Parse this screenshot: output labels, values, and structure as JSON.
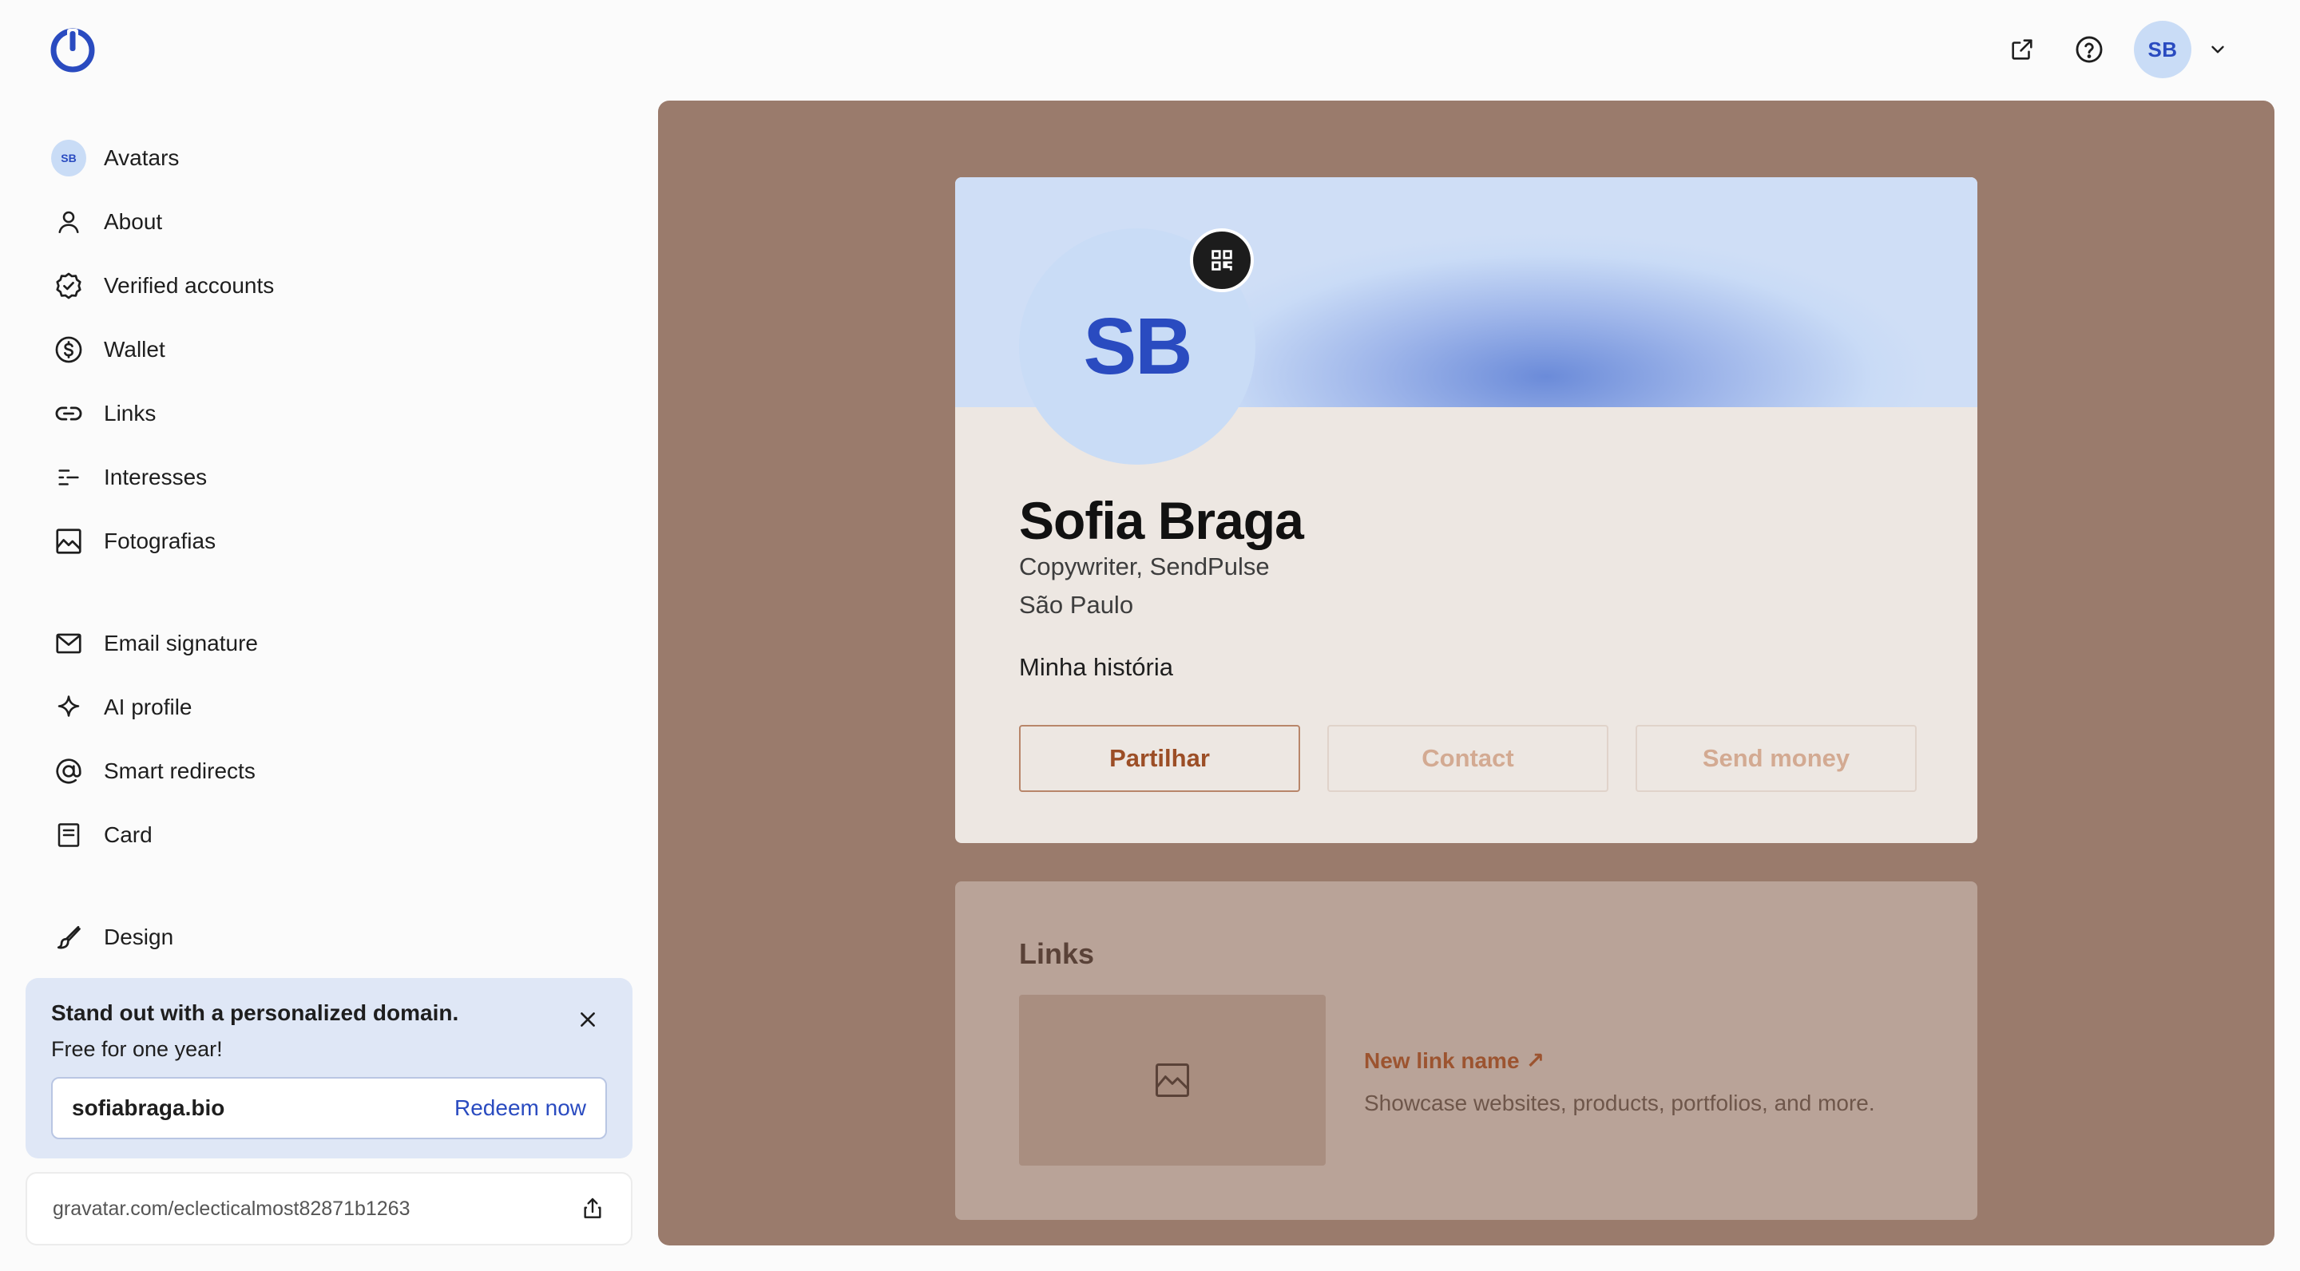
{
  "header": {
    "logo_icon": "gravatar-logo-icon",
    "external_link_icon": "external-link-icon",
    "help_icon": "help-icon",
    "user_initials": "SB",
    "chevron_icon": "chevron-down-icon"
  },
  "sidebar": {
    "groups": [
      [
        {
          "label": "Avatars",
          "icon": "mini-avatar",
          "initials": "SB"
        },
        {
          "label": "About",
          "icon": "person-icon"
        },
        {
          "label": "Verified accounts",
          "icon": "verified-badge-icon"
        },
        {
          "label": "Wallet",
          "icon": "dollar-icon"
        },
        {
          "label": "Links",
          "icon": "link-icon"
        },
        {
          "label": "Interesses",
          "icon": "interests-icon"
        },
        {
          "label": "Fotografias",
          "icon": "image-icon"
        }
      ],
      [
        {
          "label": "Email signature",
          "icon": "mail-icon"
        },
        {
          "label": "AI profile",
          "icon": "sparkle-icon"
        },
        {
          "label": "Smart redirects",
          "icon": "at-icon"
        },
        {
          "label": "Card",
          "icon": "card-icon"
        }
      ],
      [
        {
          "label": "Design",
          "icon": "brush-icon"
        }
      ]
    ],
    "promo": {
      "title": "Stand out with a personalized domain.",
      "subtitle": "Free for one year!",
      "domain": "sofiabraga.bio",
      "redeem_label": "Redeem now",
      "close_icon": "close-icon"
    },
    "profile_url": "gravatar.com/eclecticalmost82871b1263",
    "share_icon": "share-icon"
  },
  "preview": {
    "colors": {
      "background": "#9a7b6c",
      "card": "#ede7e2",
      "accent": "#9c4e26"
    },
    "profile": {
      "initials": "SB",
      "name": "Sofia Braga",
      "job": "Copywriter, SendPulse",
      "location": "São Paulo",
      "story_label": "Minha história",
      "buttons": {
        "share": "Partilhar",
        "contact": "Contact",
        "send_money": "Send money"
      },
      "qr_icon": "qr-code-icon"
    },
    "links": {
      "title": "Links",
      "link_name": "New link name",
      "link_arrow": "↗",
      "link_description": "Showcase websites, products, portfolios, and more.",
      "thumb_icon": "image-placeholder-icon"
    }
  }
}
